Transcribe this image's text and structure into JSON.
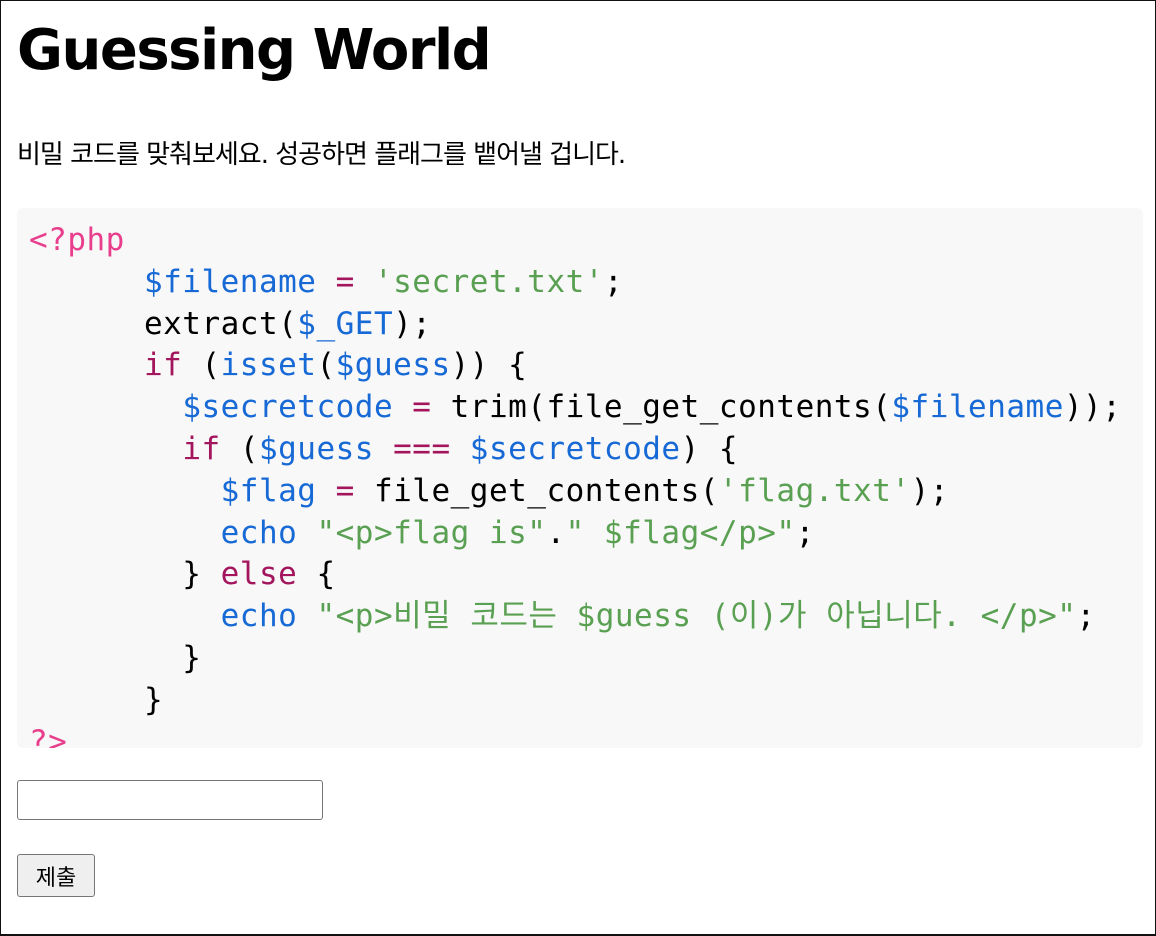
{
  "page": {
    "title": "Guessing World",
    "description": "비밀 코드를 맞춰보세요. 성공하면 플래그를 뱉어낼 겁니다."
  },
  "code": {
    "lines": [
      [
        {
          "t": "<?php",
          "k": "tag"
        }
      ],
      [
        {
          "t": "      ",
          "k": "plain"
        },
        {
          "t": "$filename",
          "k": "var"
        },
        {
          "t": " = ",
          "k": "kw"
        },
        {
          "t": "'secret.txt'",
          "k": "str"
        },
        {
          "t": ";",
          "k": "plain"
        }
      ],
      [
        {
          "t": "      extract(",
          "k": "plain"
        },
        {
          "t": "$_GET",
          "k": "var"
        },
        {
          "t": ");",
          "k": "plain"
        }
      ],
      [
        {
          "t": "      ",
          "k": "plain"
        },
        {
          "t": "if",
          "k": "kw"
        },
        {
          "t": " (",
          "k": "plain"
        },
        {
          "t": "isset",
          "k": "builtin"
        },
        {
          "t": "(",
          "k": "plain"
        },
        {
          "t": "$guess",
          "k": "var"
        },
        {
          "t": ")) {",
          "k": "plain"
        }
      ],
      [
        {
          "t": "        ",
          "k": "plain"
        },
        {
          "t": "$secretcode",
          "k": "var"
        },
        {
          "t": " = ",
          "k": "kw"
        },
        {
          "t": "trim(file_get_contents(",
          "k": "plain"
        },
        {
          "t": "$filename",
          "k": "var"
        },
        {
          "t": "));",
          "k": "plain"
        }
      ],
      [
        {
          "t": "        ",
          "k": "plain"
        },
        {
          "t": "if",
          "k": "kw"
        },
        {
          "t": " (",
          "k": "plain"
        },
        {
          "t": "$guess",
          "k": "var"
        },
        {
          "t": " === ",
          "k": "kw"
        },
        {
          "t": "$secretcode",
          "k": "var"
        },
        {
          "t": ") {",
          "k": "plain"
        }
      ],
      [
        {
          "t": "          ",
          "k": "plain"
        },
        {
          "t": "$flag",
          "k": "var"
        },
        {
          "t": " = ",
          "k": "kw"
        },
        {
          "t": "file_get_contents(",
          "k": "plain"
        },
        {
          "t": "'flag.txt'",
          "k": "str"
        },
        {
          "t": ");",
          "k": "plain"
        }
      ],
      [
        {
          "t": "          ",
          "k": "plain"
        },
        {
          "t": "echo",
          "k": "builtin"
        },
        {
          "t": " ",
          "k": "plain"
        },
        {
          "t": "\"<p>flag is\"",
          "k": "str"
        },
        {
          "t": ".",
          "k": "plain"
        },
        {
          "t": "\" $flag</p>\"",
          "k": "str"
        },
        {
          "t": ";",
          "k": "plain"
        }
      ],
      [
        {
          "t": "        } ",
          "k": "plain"
        },
        {
          "t": "else",
          "k": "kw"
        },
        {
          "t": " {",
          "k": "plain"
        }
      ],
      [
        {
          "t": "          ",
          "k": "plain"
        },
        {
          "t": "echo",
          "k": "builtin"
        },
        {
          "t": " ",
          "k": "plain"
        },
        {
          "t": "\"<p>비밀 코드는 $guess (이)가 아닙니다. </p>\"",
          "k": "str"
        },
        {
          "t": ";",
          "k": "plain"
        }
      ],
      [
        {
          "t": "        }",
          "k": "plain"
        }
      ],
      [
        {
          "t": "      }",
          "k": "plain"
        }
      ],
      [
        {
          "t": "?>",
          "k": "tag"
        }
      ]
    ]
  },
  "form": {
    "guess_value": "",
    "submit_label": "제출"
  },
  "colors": {
    "tag": "#e83e8c",
    "var": "#1769d6",
    "str": "#5aa052",
    "kw": "#a3165e",
    "code_bg": "#f8f8f8"
  }
}
